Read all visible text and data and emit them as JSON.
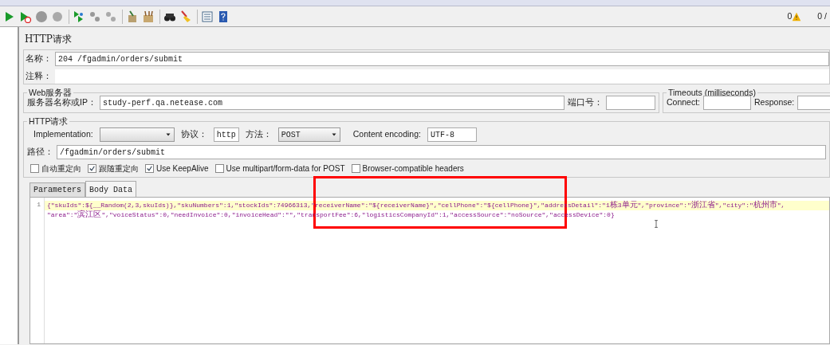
{
  "status": {
    "warnings": "0",
    "threads": "0 /"
  },
  "title": "HTTP请求",
  "name_field": {
    "label": "名称：",
    "value": "204 /fgadmin/orders/submit"
  },
  "comment_field": {
    "label": "注释："
  },
  "web_server": {
    "legend": "Web服务器",
    "server_label": "服务器名称或IP：",
    "server": "study-perf.qa.netease.com",
    "port_label": "端口号："
  },
  "timeouts": {
    "legend": "Timeouts (milliseconds)",
    "connect_label": "Connect:",
    "response_label": "Response:"
  },
  "http_request": {
    "legend": "HTTP请求",
    "implementation_label": "Implementation:",
    "protocol_label": "协议：",
    "protocol": "http",
    "method_label": "方法：",
    "method": "POST",
    "encoding_label": "Content encoding:",
    "encoding": "UTF-8",
    "path_label": "路径：",
    "path": "/fgadmin/orders/submit"
  },
  "checkboxes": [
    {
      "label": "自动重定向",
      "checked": false
    },
    {
      "label": "跟随重定向",
      "checked": true
    },
    {
      "label": "Use KeepAlive",
      "checked": true
    },
    {
      "label": "Use multipart/form-data for POST",
      "checked": false
    },
    {
      "label": "Browser-compatible headers",
      "checked": false
    }
  ],
  "tabs": [
    {
      "label": "Parameters",
      "selected": false
    },
    {
      "label": "Body Data",
      "selected": true
    }
  ],
  "editor": {
    "line_number": "1",
    "rows": [
      {
        "text": "{\"skuIds\":${__Random(2,3,skuIds)},\"skuNumbers\":1,\"stockIds\":74966313,\"receiverName\":\"${receiverName}\",\"cellPhone\":\"${cellPhone}\",\"addressDetail\":\"1栋3单元\",\"province\":\"浙江省\",\"city\":\"杭州市\",",
        "highlighted": true
      },
      {
        "text": "\"area\":\"滨江区\",\"voiceStatus\":0,\"needInvoice\":0,\"invoiceHead\":\"\",\"transportFee\":6,\"logisticsCompanyId\":1,\"accessSource\":\"noSource\",\"accessDevice\":0}",
        "highlighted": false
      }
    ]
  }
}
